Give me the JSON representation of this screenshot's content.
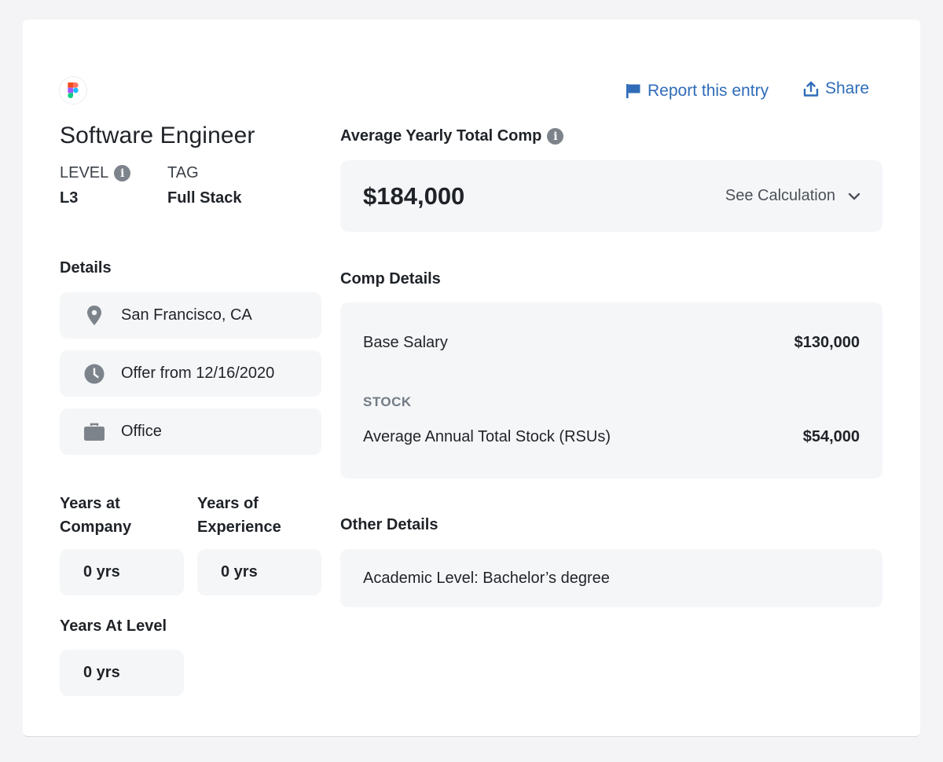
{
  "header": {
    "report_label": "Report this entry",
    "share_label": "Share"
  },
  "entry": {
    "title": "Software Engineer",
    "level_label": "LEVEL",
    "level_value": "L3",
    "tag_label": "TAG",
    "tag_value": "Full Stack"
  },
  "details": {
    "heading": "Details",
    "location": "San Francisco, CA",
    "offer_date": "Offer from 12/16/2020",
    "work_type": "Office"
  },
  "years": {
    "at_company_label": "Years at Company",
    "at_company_value": "0 yrs",
    "experience_label": "Years of Experience",
    "experience_value": "0 yrs",
    "at_level_label": "Years At Level",
    "at_level_value": "0 yrs"
  },
  "total_comp": {
    "heading": "Average Yearly Total Comp",
    "amount": "$184,000",
    "see_calculation": "See Calculation"
  },
  "comp_details": {
    "heading": "Comp Details",
    "base_salary_label": "Base Salary",
    "base_salary_value": "$130,000",
    "stock_section_label": "STOCK",
    "stock_label": "Average Annual Total Stock (RSUs)",
    "stock_value": "$54,000"
  },
  "other_details": {
    "heading": "Other Details",
    "academic_level": "Academic Level: Bachelor’s degree"
  },
  "colors": {
    "accent": "#2f6cb8",
    "pill_bg": "#f5f6f8",
    "icon_gray": "#7d838b"
  },
  "icons": {
    "logo": "figma-logo-icon",
    "report": "flag-icon",
    "share": "upload-icon",
    "info": "info-icon",
    "location": "map-pin-icon",
    "offer": "clock-icon",
    "work_type": "briefcase-icon",
    "expand": "chevron-down-icon"
  }
}
